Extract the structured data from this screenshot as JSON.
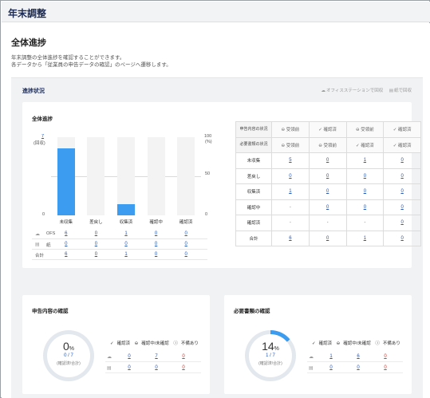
{
  "app": {
    "title": "年末調整"
  },
  "page": {
    "title": "全体進捗",
    "desc_line1": "年末調整の全体進捗を確認することができます。",
    "desc_line2": "各データから「従業員の申告データの確認」のページへ遷移します。"
  },
  "panel": {
    "title": "進捗状況",
    "link_office": "オフィスステーションで回収",
    "link_paper": "紙で回収"
  },
  "progress_card": {
    "title": "全体進捗",
    "y_left_top": "7",
    "y_left_unit": "(回収)",
    "y_left_zero": "0",
    "y_right_top": "100",
    "y_right_unit": "(%)",
    "y_right_mid": "50",
    "y_right_zero": "0",
    "categories": [
      "未収集",
      "差戻し",
      "収集済",
      "確認中",
      "確認済"
    ],
    "rows": [
      {
        "label": "OFS",
        "values": [
          "6",
          "0",
          "1",
          "0",
          "0"
        ]
      },
      {
        "label": "紙",
        "values": [
          "0",
          "0",
          "0",
          "0",
          "0"
        ]
      },
      {
        "label": "合計",
        "values": [
          "6",
          "0",
          "1",
          "0",
          "0"
        ]
      }
    ]
  },
  "chart_data": {
    "type": "bar",
    "categories": [
      "未収集",
      "差戻し",
      "収集済",
      "確認中",
      "確認済"
    ],
    "values": [
      6,
      0,
      1,
      0,
      0
    ],
    "ylim": [
      0,
      7
    ]
  },
  "status_table": {
    "header_rows": [
      {
        "label": "申告内容の状況",
        "cells": [
          "受領前",
          "確認済",
          "受領前",
          "確認済"
        ]
      },
      {
        "label": "必要書類の状況",
        "cells": [
          "受領前",
          "受領前",
          "確認済",
          "確認済"
        ]
      }
    ],
    "header_icons": [
      [
        "minus-circle-icon",
        "check-icon",
        "minus-circle-icon",
        "check-icon"
      ],
      [
        "minus-circle-icon",
        "minus-circle-icon",
        "check-icon",
        "check-icon"
      ]
    ],
    "rows": [
      {
        "label": "未収集",
        "values": [
          "5",
          "0",
          "1",
          "0"
        ]
      },
      {
        "label": "差戻し",
        "values": [
          "0",
          "0",
          "0",
          "0"
        ]
      },
      {
        "label": "収集済",
        "values": [
          "1",
          "0",
          "0",
          "0"
        ]
      },
      {
        "label": "確認中",
        "values": [
          "-",
          "0",
          "0",
          "0"
        ]
      },
      {
        "label": "確認済",
        "values": [
          "-",
          "-",
          "-",
          "0"
        ]
      },
      {
        "label": "合計",
        "values": [
          "6",
          "0",
          "1",
          "0"
        ]
      }
    ]
  },
  "declaration_card": {
    "title": "申告内容の確認",
    "percent": "0",
    "percent_sign": "%",
    "fraction": "0 / 7",
    "sub": "(確認済/合計)",
    "legend": [
      "確認済",
      "確認中/未確認",
      "不備あり"
    ],
    "rows": [
      {
        "icon": "cloud-icon",
        "values": [
          "0",
          "7",
          "0"
        ]
      },
      {
        "icon": "document-icon",
        "values": [
          "0",
          "0",
          "0"
        ]
      }
    ],
    "progress_fraction": 0
  },
  "documents_card": {
    "title": "必要書類の確認",
    "percent": "14",
    "percent_sign": "%",
    "fraction": "1 / 7",
    "sub": "(確認済/合計)",
    "legend": [
      "確認済",
      "確認中/未確認",
      "不備あり"
    ],
    "rows": [
      {
        "icon": "cloud-icon",
        "values": [
          "1",
          "6",
          "0"
        ]
      },
      {
        "icon": "document-icon",
        "values": [
          "0",
          "0",
          "0"
        ]
      }
    ],
    "progress_fraction": 0.14
  },
  "colors": {
    "accent": "#3b9cf0",
    "link": "#2456b8",
    "error": "#d0342c",
    "title": "#1a2a55"
  }
}
